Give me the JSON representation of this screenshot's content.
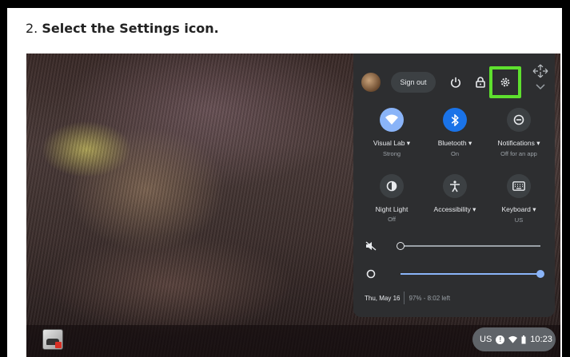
{
  "step": {
    "number": "2.",
    "text": "Select the Settings icon."
  },
  "quick_settings": {
    "sign_out_label": "Sign out",
    "tiles": [
      {
        "label": "Visual Lab ▾",
        "sub": "Strong",
        "icon": "wifi-icon",
        "state": "on"
      },
      {
        "label": "Bluetooth ▾",
        "sub": "On",
        "icon": "bluetooth-icon",
        "state": "on"
      },
      {
        "label": "Notifications ▾",
        "sub": "Off for an app",
        "icon": "notifications-off-icon",
        "state": "off"
      },
      {
        "label": "Night Light",
        "sub": "Off",
        "icon": "night-light-icon",
        "state": "off"
      },
      {
        "label": "Accessibility ▾",
        "sub": "",
        "icon": "accessibility-icon",
        "state": "off"
      },
      {
        "label": "Keyboard ▾",
        "sub": "US",
        "icon": "keyboard-icon",
        "state": "off"
      }
    ],
    "volume_level": 0,
    "brightness_level": 100,
    "date": "Thu, May 16",
    "battery": "97% - 8:02 left"
  },
  "status_area": {
    "ime": "US",
    "info": "!",
    "time": "10:23"
  },
  "colors": {
    "highlight": "#5ee02e",
    "tile_on": "#1a73e8",
    "panel_bg": "#2d2e30",
    "accent": "#8ab4f8"
  }
}
